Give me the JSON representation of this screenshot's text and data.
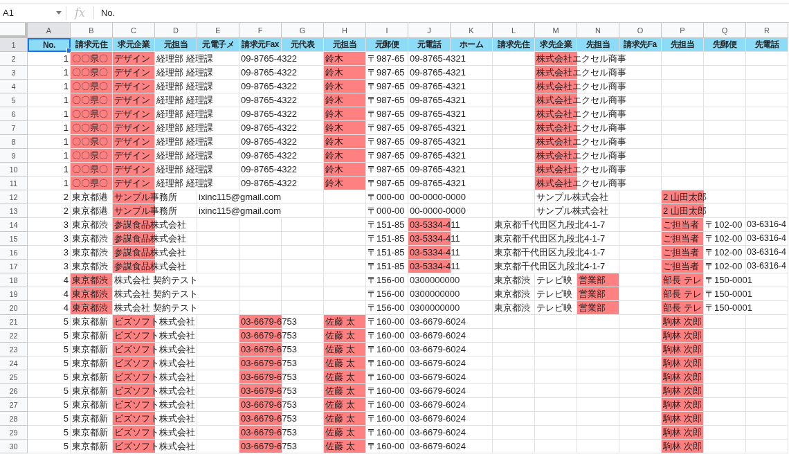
{
  "formula_bar": {
    "cell_ref": "A1",
    "function_label": "fx",
    "formula": "No."
  },
  "columns": [
    {
      "label": "A",
      "selected": true
    },
    {
      "label": "B",
      "selected": false
    },
    {
      "label": "C",
      "selected": false
    },
    {
      "label": "D",
      "selected": false
    },
    {
      "label": "E",
      "selected": false
    },
    {
      "label": "F",
      "selected": false
    },
    {
      "label": "G",
      "selected": false
    },
    {
      "label": "H",
      "selected": false
    },
    {
      "label": "I",
      "selected": false
    },
    {
      "label": "J",
      "selected": false
    },
    {
      "label": "K",
      "selected": false
    },
    {
      "label": "L",
      "selected": false
    },
    {
      "label": "M",
      "selected": false
    },
    {
      "label": "N",
      "selected": false
    },
    {
      "label": "O",
      "selected": false
    },
    {
      "label": "P",
      "selected": false
    },
    {
      "label": "Q",
      "selected": false
    },
    {
      "label": "R",
      "selected": false
    }
  ],
  "rows": [
    {
      "number": "1",
      "selected": true,
      "kind": "header",
      "col_a": "No.",
      "col_a_selected": true,
      "cells": [
        {
          "text": "請求元住",
          "highlight": false
        },
        {
          "text": "求元企業",
          "highlight": false
        },
        {
          "text": "元担当",
          "highlight": false
        },
        {
          "text": "元電子メ",
          "highlight": false
        },
        {
          "text": "請求元Fax",
          "highlight": false
        },
        {
          "text": "元代表",
          "highlight": false
        },
        {
          "text": "元担当",
          "highlight": false
        },
        {
          "text": "元郵便",
          "highlight": false
        },
        {
          "text": "元電話",
          "highlight": false
        },
        {
          "text": "ホーム",
          "highlight": false
        },
        {
          "text": "請求先住",
          "highlight": false
        },
        {
          "text": "求先企業",
          "highlight": false
        },
        {
          "text": "先担当",
          "highlight": false
        },
        {
          "text": "請求先Fa",
          "highlight": false
        },
        {
          "text": "先担当",
          "highlight": false
        },
        {
          "text": "先郵便",
          "highlight": false
        },
        {
          "text": "先電話",
          "highlight": false
        }
      ]
    },
    {
      "number": "2",
      "selected": false,
      "kind": "data",
      "col_a": "1",
      "col_a_selected": false,
      "cells": [
        {
          "text": "〇〇県〇",
          "highlight": true
        },
        {
          "text": "デザイン",
          "highlight": true
        },
        {
          "text": "経理部 経理課",
          "highlight": false
        },
        {
          "highlight": false
        },
        {
          "text": "09-8765-4322",
          "highlight": false
        },
        {
          "highlight": false
        },
        {
          "text": "鈴木",
          "highlight": true
        },
        {
          "text": "〒987-65",
          "highlight": false
        },
        {
          "text": "09-8765-4321",
          "highlight": false
        },
        {
          "highlight": false
        },
        {
          "highlight": false
        },
        {
          "text": "株式会社エクセル商事",
          "highlight": true
        },
        {
          "highlight": false
        },
        {
          "highlight": false
        },
        {
          "highlight": false
        },
        {
          "highlight": false
        },
        {
          "highlight": false
        }
      ]
    },
    {
      "number": "3",
      "selected": false,
      "kind": "data",
      "col_a": "1",
      "col_a_selected": false,
      "cells": [
        {
          "text": "〇〇県〇",
          "highlight": true
        },
        {
          "text": "デザイン",
          "highlight": true
        },
        {
          "text": "経理部 経理課",
          "highlight": false
        },
        {
          "highlight": false
        },
        {
          "text": "09-8765-4322",
          "highlight": false
        },
        {
          "highlight": false
        },
        {
          "text": "鈴木",
          "highlight": true
        },
        {
          "text": "〒987-65",
          "highlight": false
        },
        {
          "text": "09-8765-4321",
          "highlight": false
        },
        {
          "highlight": false
        },
        {
          "highlight": false
        },
        {
          "text": "株式会社エクセル商事",
          "highlight": true
        },
        {
          "highlight": false
        },
        {
          "highlight": false
        },
        {
          "highlight": false
        },
        {
          "highlight": false
        },
        {
          "highlight": false
        }
      ]
    },
    {
      "number": "4",
      "selected": false,
      "kind": "data",
      "col_a": "1",
      "col_a_selected": false,
      "cells": [
        {
          "text": "〇〇県〇",
          "highlight": true
        },
        {
          "text": "デザイン",
          "highlight": true
        },
        {
          "text": "経理部 経理課",
          "highlight": false
        },
        {
          "highlight": false
        },
        {
          "text": "09-8765-4322",
          "highlight": false
        },
        {
          "highlight": false
        },
        {
          "text": "鈴木",
          "highlight": true
        },
        {
          "text": "〒987-65",
          "highlight": false
        },
        {
          "text": "09-8765-4321",
          "highlight": false
        },
        {
          "highlight": false
        },
        {
          "highlight": false
        },
        {
          "text": "株式会社エクセル商事",
          "highlight": true
        },
        {
          "highlight": false
        },
        {
          "highlight": false
        },
        {
          "highlight": false
        },
        {
          "highlight": false
        },
        {
          "highlight": false
        }
      ]
    },
    {
      "number": "5",
      "selected": false,
      "kind": "data",
      "col_a": "1",
      "col_a_selected": false,
      "cells": [
        {
          "text": "〇〇県〇",
          "highlight": true
        },
        {
          "text": "デザイン",
          "highlight": true
        },
        {
          "text": "経理部 経理課",
          "highlight": false
        },
        {
          "highlight": false
        },
        {
          "text": "09-8765-4322",
          "highlight": false
        },
        {
          "highlight": false
        },
        {
          "text": "鈴木",
          "highlight": true
        },
        {
          "text": "〒987-65",
          "highlight": false
        },
        {
          "text": "09-8765-4321",
          "highlight": false
        },
        {
          "highlight": false
        },
        {
          "highlight": false
        },
        {
          "text": "株式会社エクセル商事",
          "highlight": true
        },
        {
          "highlight": false
        },
        {
          "highlight": false
        },
        {
          "highlight": false
        },
        {
          "highlight": false
        },
        {
          "highlight": false
        }
      ]
    },
    {
      "number": "6",
      "selected": false,
      "kind": "data",
      "col_a": "1",
      "col_a_selected": false,
      "cells": [
        {
          "text": "〇〇県〇",
          "highlight": true
        },
        {
          "text": "デザイン",
          "highlight": true
        },
        {
          "text": "経理部 経理課",
          "highlight": false
        },
        {
          "highlight": false
        },
        {
          "text": "09-8765-4322",
          "highlight": false
        },
        {
          "highlight": false
        },
        {
          "text": "鈴木",
          "highlight": true
        },
        {
          "text": "〒987-65",
          "highlight": false
        },
        {
          "text": "09-8765-4321",
          "highlight": false
        },
        {
          "highlight": false
        },
        {
          "highlight": false
        },
        {
          "text": "株式会社エクセル商事",
          "highlight": true
        },
        {
          "highlight": false
        },
        {
          "highlight": false
        },
        {
          "highlight": false
        },
        {
          "highlight": false
        },
        {
          "highlight": false
        }
      ]
    },
    {
      "number": "7",
      "selected": false,
      "kind": "data",
      "col_a": "1",
      "col_a_selected": false,
      "cells": [
        {
          "text": "〇〇県〇",
          "highlight": true
        },
        {
          "text": "デザイン",
          "highlight": true
        },
        {
          "text": "経理部 経理課",
          "highlight": false
        },
        {
          "highlight": false
        },
        {
          "text": "09-8765-4322",
          "highlight": false
        },
        {
          "highlight": false
        },
        {
          "text": "鈴木",
          "highlight": true
        },
        {
          "text": "〒987-65",
          "highlight": false
        },
        {
          "text": "09-8765-4321",
          "highlight": false
        },
        {
          "highlight": false
        },
        {
          "highlight": false
        },
        {
          "text": "株式会社エクセル商事",
          "highlight": true
        },
        {
          "highlight": false
        },
        {
          "highlight": false
        },
        {
          "highlight": false
        },
        {
          "highlight": false
        },
        {
          "highlight": false
        }
      ]
    },
    {
      "number": "8",
      "selected": false,
      "kind": "data",
      "col_a": "1",
      "col_a_selected": false,
      "cells": [
        {
          "text": "〇〇県〇",
          "highlight": true
        },
        {
          "text": "デザイン",
          "highlight": true
        },
        {
          "text": "経理部 経理課",
          "highlight": false
        },
        {
          "highlight": false
        },
        {
          "text": "09-8765-4322",
          "highlight": false
        },
        {
          "highlight": false
        },
        {
          "text": "鈴木",
          "highlight": true
        },
        {
          "text": "〒987-65",
          "highlight": false
        },
        {
          "text": "09-8765-4321",
          "highlight": false
        },
        {
          "highlight": false
        },
        {
          "highlight": false
        },
        {
          "text": "株式会社エクセル商事",
          "highlight": true
        },
        {
          "highlight": false
        },
        {
          "highlight": false
        },
        {
          "highlight": false
        },
        {
          "highlight": false
        },
        {
          "highlight": false
        }
      ]
    },
    {
      "number": "9",
      "selected": false,
      "kind": "data",
      "col_a": "1",
      "col_a_selected": false,
      "cells": [
        {
          "text": "〇〇県〇",
          "highlight": true
        },
        {
          "text": "デザイン",
          "highlight": true
        },
        {
          "text": "経理部 経理課",
          "highlight": false
        },
        {
          "highlight": false
        },
        {
          "text": "09-8765-4322",
          "highlight": false
        },
        {
          "highlight": false
        },
        {
          "text": "鈴木",
          "highlight": true
        },
        {
          "text": "〒987-65",
          "highlight": false
        },
        {
          "text": "09-8765-4321",
          "highlight": false
        },
        {
          "highlight": false
        },
        {
          "highlight": false
        },
        {
          "text": "株式会社エクセル商事",
          "highlight": true
        },
        {
          "highlight": false
        },
        {
          "highlight": false
        },
        {
          "highlight": false
        },
        {
          "highlight": false
        },
        {
          "highlight": false
        }
      ]
    },
    {
      "number": "10",
      "selected": false,
      "kind": "data",
      "col_a": "1",
      "col_a_selected": false,
      "cells": [
        {
          "text": "〇〇県〇",
          "highlight": true
        },
        {
          "text": "デザイン",
          "highlight": true
        },
        {
          "text": "経理部 経理課",
          "highlight": false
        },
        {
          "highlight": false
        },
        {
          "text": "09-8765-4322",
          "highlight": false
        },
        {
          "highlight": false
        },
        {
          "text": "鈴木",
          "highlight": true
        },
        {
          "text": "〒987-65",
          "highlight": false
        },
        {
          "text": "09-8765-4321",
          "highlight": false
        },
        {
          "highlight": false
        },
        {
          "highlight": false
        },
        {
          "text": "株式会社エクセル商事",
          "highlight": true
        },
        {
          "highlight": false
        },
        {
          "highlight": false
        },
        {
          "highlight": false
        },
        {
          "highlight": false
        },
        {
          "highlight": false
        }
      ]
    },
    {
      "number": "11",
      "selected": false,
      "kind": "data",
      "col_a": "1",
      "col_a_selected": false,
      "cells": [
        {
          "text": "〇〇県〇",
          "highlight": true
        },
        {
          "text": "デザイン",
          "highlight": true
        },
        {
          "text": "経理部 経理課",
          "highlight": false
        },
        {
          "highlight": false
        },
        {
          "text": "09-8765-4322",
          "highlight": false
        },
        {
          "highlight": false
        },
        {
          "text": "鈴木",
          "highlight": true
        },
        {
          "text": "〒987-65",
          "highlight": false
        },
        {
          "text": "09-8765-4321",
          "highlight": false
        },
        {
          "highlight": false
        },
        {
          "highlight": false
        },
        {
          "text": "株式会社エクセル商事",
          "highlight": true
        },
        {
          "highlight": false
        },
        {
          "highlight": false
        },
        {
          "highlight": false
        },
        {
          "highlight": false
        },
        {
          "highlight": false
        }
      ]
    },
    {
      "number": "12",
      "selected": false,
      "kind": "data",
      "col_a": "2",
      "col_a_selected": false,
      "cells": [
        {
          "text": "東京都港",
          "highlight": false
        },
        {
          "text": "サンプル事務所",
          "highlight": true
        },
        {
          "highlight": false
        },
        {
          "text": "ixinc115@gmail.com",
          "highlight": false
        },
        {
          "highlight": false
        },
        {
          "highlight": false
        },
        {
          "highlight": false
        },
        {
          "text": "〒000-00",
          "highlight": false
        },
        {
          "text": "00-0000-0000",
          "highlight": false
        },
        {
          "highlight": false
        },
        {
          "highlight": false
        },
        {
          "text": "サンプル株式会社",
          "highlight": false
        },
        {
          "highlight": false
        },
        {
          "highlight": false
        },
        {
          "text": "2 山田太郎",
          "highlight": true
        },
        {
          "highlight": false
        },
        {
          "highlight": false
        }
      ]
    },
    {
      "number": "13",
      "selected": false,
      "kind": "data",
      "col_a": "2",
      "col_a_selected": false,
      "cells": [
        {
          "text": "東京都港",
          "highlight": false
        },
        {
          "text": "サンプル事務所",
          "highlight": true
        },
        {
          "highlight": false
        },
        {
          "text": "ixinc115@gmail.com",
          "highlight": false
        },
        {
          "highlight": false
        },
        {
          "highlight": false
        },
        {
          "highlight": false
        },
        {
          "text": "〒000-00",
          "highlight": false
        },
        {
          "text": "00-0000-0000",
          "highlight": false
        },
        {
          "highlight": false
        },
        {
          "highlight": false
        },
        {
          "text": "サンプル株式会社",
          "highlight": false
        },
        {
          "highlight": false
        },
        {
          "highlight": false
        },
        {
          "text": "2 山田太郎",
          "highlight": true
        },
        {
          "highlight": false
        },
        {
          "highlight": false
        }
      ]
    },
    {
      "number": "14",
      "selected": false,
      "kind": "data",
      "col_a": "3",
      "col_a_selected": false,
      "cells": [
        {
          "text": "東京都渋",
          "highlight": false
        },
        {
          "text": "参謀食品株式会社",
          "highlight": true
        },
        {
          "highlight": false
        },
        {
          "highlight": false
        },
        {
          "highlight": false
        },
        {
          "highlight": false
        },
        {
          "highlight": false
        },
        {
          "text": "〒151-85",
          "highlight": false
        },
        {
          "text": "03-5334-411",
          "highlight": true
        },
        {
          "highlight": false
        },
        {
          "text": "東京都千代田区九段北4-1-7",
          "highlight": false
        },
        {
          "highlight": false
        },
        {
          "highlight": false
        },
        {
          "highlight": false
        },
        {
          "text": "ご担当者",
          "highlight": true
        },
        {
          "text": "〒102-00",
          "highlight": false
        },
        {
          "text": "03-6316-4",
          "highlight": false
        }
      ]
    },
    {
      "number": "15",
      "selected": false,
      "kind": "data",
      "col_a": "3",
      "col_a_selected": false,
      "cells": [
        {
          "text": "東京都渋",
          "highlight": false
        },
        {
          "text": "参謀食品株式会社",
          "highlight": true
        },
        {
          "highlight": false
        },
        {
          "highlight": false
        },
        {
          "highlight": false
        },
        {
          "highlight": false
        },
        {
          "highlight": false
        },
        {
          "text": "〒151-85",
          "highlight": false
        },
        {
          "text": "03-5334-411",
          "highlight": true
        },
        {
          "highlight": false
        },
        {
          "text": "東京都千代田区九段北4-1-7",
          "highlight": false
        },
        {
          "highlight": false
        },
        {
          "highlight": false
        },
        {
          "highlight": false
        },
        {
          "text": "ご担当者",
          "highlight": true
        },
        {
          "text": "〒102-00",
          "highlight": false
        },
        {
          "text": "03-6316-4",
          "highlight": false
        }
      ]
    },
    {
      "number": "16",
      "selected": false,
      "kind": "data",
      "col_a": "3",
      "col_a_selected": false,
      "cells": [
        {
          "text": "東京都渋",
          "highlight": false
        },
        {
          "text": "参謀食品株式会社",
          "highlight": true
        },
        {
          "highlight": false
        },
        {
          "highlight": false
        },
        {
          "highlight": false
        },
        {
          "highlight": false
        },
        {
          "highlight": false
        },
        {
          "text": "〒151-85",
          "highlight": false
        },
        {
          "text": "03-5334-411",
          "highlight": true
        },
        {
          "highlight": false
        },
        {
          "text": "東京都千代田区九段北4-1-7",
          "highlight": false
        },
        {
          "highlight": false
        },
        {
          "highlight": false
        },
        {
          "highlight": false
        },
        {
          "text": "ご担当者",
          "highlight": true
        },
        {
          "text": "〒102-00",
          "highlight": false
        },
        {
          "text": "03-6316-4",
          "highlight": false
        }
      ]
    },
    {
      "number": "17",
      "selected": false,
      "kind": "data",
      "col_a": "3",
      "col_a_selected": false,
      "cells": [
        {
          "text": "東京都渋",
          "highlight": false
        },
        {
          "text": "参謀食品株式会社",
          "highlight": true
        },
        {
          "highlight": false
        },
        {
          "highlight": false
        },
        {
          "highlight": false
        },
        {
          "highlight": false
        },
        {
          "highlight": false
        },
        {
          "text": "〒151-85",
          "highlight": false
        },
        {
          "text": "03-5334-411",
          "highlight": true
        },
        {
          "highlight": false
        },
        {
          "text": "東京都千代田区九段北4-1-7",
          "highlight": false
        },
        {
          "highlight": false
        },
        {
          "highlight": false
        },
        {
          "highlight": false
        },
        {
          "text": "ご担当者",
          "highlight": true
        },
        {
          "text": "〒102-00",
          "highlight": false
        },
        {
          "text": "03-6316-4",
          "highlight": false
        }
      ]
    },
    {
      "number": "18",
      "selected": false,
      "kind": "data",
      "col_a": "4",
      "col_a_selected": false,
      "cells": [
        {
          "text": "東京都渋",
          "highlight": true
        },
        {
          "text": "株式会社 契約テスト",
          "highlight": false
        },
        {
          "highlight": false
        },
        {
          "highlight": false
        },
        {
          "highlight": false
        },
        {
          "highlight": false
        },
        {
          "highlight": false
        },
        {
          "text": "〒156-00",
          "highlight": false
        },
        {
          "text": "0300000000",
          "highlight": false
        },
        {
          "highlight": false
        },
        {
          "text": "東京都渋",
          "highlight": false
        },
        {
          "text": "テレビ映",
          "highlight": false
        },
        {
          "text": "営業部",
          "highlight": true
        },
        {
          "highlight": false
        },
        {
          "text": "部長 テレ",
          "highlight": true
        },
        {
          "text": "〒150-0001",
          "highlight": false
        },
        {
          "highlight": false
        }
      ]
    },
    {
      "number": "19",
      "selected": false,
      "kind": "data",
      "col_a": "4",
      "col_a_selected": false,
      "cells": [
        {
          "text": "東京都渋",
          "highlight": true
        },
        {
          "text": "株式会社 契約テスト",
          "highlight": false
        },
        {
          "highlight": false
        },
        {
          "highlight": false
        },
        {
          "highlight": false
        },
        {
          "highlight": false
        },
        {
          "highlight": false
        },
        {
          "text": "〒156-00",
          "highlight": false
        },
        {
          "text": "0300000000",
          "highlight": false
        },
        {
          "highlight": false
        },
        {
          "text": "東京都渋",
          "highlight": false
        },
        {
          "text": "テレビ映",
          "highlight": false
        },
        {
          "text": "営業部",
          "highlight": true
        },
        {
          "highlight": false
        },
        {
          "text": "部長 テレ",
          "highlight": true
        },
        {
          "text": "〒150-0001",
          "highlight": false
        },
        {
          "highlight": false
        }
      ]
    },
    {
      "number": "20",
      "selected": false,
      "kind": "data",
      "col_a": "4",
      "col_a_selected": false,
      "cells": [
        {
          "text": "東京都渋",
          "highlight": true
        },
        {
          "text": "株式会社 契約テスト",
          "highlight": false
        },
        {
          "highlight": false
        },
        {
          "highlight": false
        },
        {
          "highlight": false
        },
        {
          "highlight": false
        },
        {
          "highlight": false
        },
        {
          "text": "〒156-00",
          "highlight": false
        },
        {
          "text": "0300000000",
          "highlight": false
        },
        {
          "highlight": false
        },
        {
          "text": "東京都渋",
          "highlight": false
        },
        {
          "text": "テレビ映",
          "highlight": false
        },
        {
          "text": "営業部",
          "highlight": true
        },
        {
          "highlight": false
        },
        {
          "text": "部長 テレ",
          "highlight": true
        },
        {
          "text": "〒150-0001",
          "highlight": false
        },
        {
          "highlight": false
        }
      ]
    },
    {
      "number": "21",
      "selected": false,
      "kind": "data",
      "col_a": "5",
      "col_a_selected": false,
      "cells": [
        {
          "text": "東京都新",
          "highlight": false
        },
        {
          "text": "ビズソフト株式会社",
          "highlight": true
        },
        {
          "highlight": false
        },
        {
          "highlight": false
        },
        {
          "text": "03-6679-6753",
          "highlight": true
        },
        {
          "highlight": false
        },
        {
          "text": "佐藤 太",
          "highlight": true
        },
        {
          "text": "〒160-00",
          "highlight": false
        },
        {
          "text": "03-6679-6024",
          "highlight": false
        },
        {
          "highlight": false
        },
        {
          "highlight": false
        },
        {
          "highlight": false
        },
        {
          "highlight": false
        },
        {
          "highlight": false
        },
        {
          "text": "駒林 次郎",
          "highlight": true
        },
        {
          "highlight": false
        },
        {
          "highlight": false
        }
      ]
    },
    {
      "number": "22",
      "selected": false,
      "kind": "data",
      "col_a": "5",
      "col_a_selected": false,
      "cells": [
        {
          "text": "東京都新",
          "highlight": false
        },
        {
          "text": "ビズソフト株式会社",
          "highlight": true
        },
        {
          "highlight": false
        },
        {
          "highlight": false
        },
        {
          "text": "03-6679-6753",
          "highlight": true
        },
        {
          "highlight": false
        },
        {
          "text": "佐藤 太",
          "highlight": true
        },
        {
          "text": "〒160-00",
          "highlight": false
        },
        {
          "text": "03-6679-6024",
          "highlight": false
        },
        {
          "highlight": false
        },
        {
          "highlight": false
        },
        {
          "highlight": false
        },
        {
          "highlight": false
        },
        {
          "highlight": false
        },
        {
          "text": "駒林 次郎",
          "highlight": true
        },
        {
          "highlight": false
        },
        {
          "highlight": false
        }
      ]
    },
    {
      "number": "23",
      "selected": false,
      "kind": "data",
      "col_a": "5",
      "col_a_selected": false,
      "cells": [
        {
          "text": "東京都新",
          "highlight": false
        },
        {
          "text": "ビズソフト株式会社",
          "highlight": true
        },
        {
          "highlight": false
        },
        {
          "highlight": false
        },
        {
          "text": "03-6679-6753",
          "highlight": true
        },
        {
          "highlight": false
        },
        {
          "text": "佐藤 太",
          "highlight": true
        },
        {
          "text": "〒160-00",
          "highlight": false
        },
        {
          "text": "03-6679-6024",
          "highlight": false
        },
        {
          "highlight": false
        },
        {
          "highlight": false
        },
        {
          "highlight": false
        },
        {
          "highlight": false
        },
        {
          "highlight": false
        },
        {
          "text": "駒林 次郎",
          "highlight": true
        },
        {
          "highlight": false
        },
        {
          "highlight": false
        }
      ]
    },
    {
      "number": "24",
      "selected": false,
      "kind": "data",
      "col_a": "5",
      "col_a_selected": false,
      "cells": [
        {
          "text": "東京都新",
          "highlight": false
        },
        {
          "text": "ビズソフト株式会社",
          "highlight": true
        },
        {
          "highlight": false
        },
        {
          "highlight": false
        },
        {
          "text": "03-6679-6753",
          "highlight": true
        },
        {
          "highlight": false
        },
        {
          "text": "佐藤 太",
          "highlight": true
        },
        {
          "text": "〒160-00",
          "highlight": false
        },
        {
          "text": "03-6679-6024",
          "highlight": false
        },
        {
          "highlight": false
        },
        {
          "highlight": false
        },
        {
          "highlight": false
        },
        {
          "highlight": false
        },
        {
          "highlight": false
        },
        {
          "text": "駒林 次郎",
          "highlight": true
        },
        {
          "highlight": false
        },
        {
          "highlight": false
        }
      ]
    },
    {
      "number": "25",
      "selected": false,
      "kind": "data",
      "col_a": "5",
      "col_a_selected": false,
      "cells": [
        {
          "text": "東京都新",
          "highlight": false
        },
        {
          "text": "ビズソフト株式会社",
          "highlight": true
        },
        {
          "highlight": false
        },
        {
          "highlight": false
        },
        {
          "text": "03-6679-6753",
          "highlight": true
        },
        {
          "highlight": false
        },
        {
          "text": "佐藤 太",
          "highlight": true
        },
        {
          "text": "〒160-00",
          "highlight": false
        },
        {
          "text": "03-6679-6024",
          "highlight": false
        },
        {
          "highlight": false
        },
        {
          "highlight": false
        },
        {
          "highlight": false
        },
        {
          "highlight": false
        },
        {
          "highlight": false
        },
        {
          "text": "駒林 次郎",
          "highlight": true
        },
        {
          "highlight": false
        },
        {
          "highlight": false
        }
      ]
    },
    {
      "number": "26",
      "selected": false,
      "kind": "data",
      "col_a": "5",
      "col_a_selected": false,
      "cells": [
        {
          "text": "東京都新",
          "highlight": false
        },
        {
          "text": "ビズソフト株式会社",
          "highlight": true
        },
        {
          "highlight": false
        },
        {
          "highlight": false
        },
        {
          "text": "03-6679-6753",
          "highlight": true
        },
        {
          "highlight": false
        },
        {
          "text": "佐藤 太",
          "highlight": true
        },
        {
          "text": "〒160-00",
          "highlight": false
        },
        {
          "text": "03-6679-6024",
          "highlight": false
        },
        {
          "highlight": false
        },
        {
          "highlight": false
        },
        {
          "highlight": false
        },
        {
          "highlight": false
        },
        {
          "highlight": false
        },
        {
          "text": "駒林 次郎",
          "highlight": true
        },
        {
          "highlight": false
        },
        {
          "highlight": false
        }
      ]
    },
    {
      "number": "27",
      "selected": false,
      "kind": "data",
      "col_a": "5",
      "col_a_selected": false,
      "cells": [
        {
          "text": "東京都新",
          "highlight": false
        },
        {
          "text": "ビズソフト株式会社",
          "highlight": true
        },
        {
          "highlight": false
        },
        {
          "highlight": false
        },
        {
          "text": "03-6679-6753",
          "highlight": true
        },
        {
          "highlight": false
        },
        {
          "text": "佐藤 太",
          "highlight": true
        },
        {
          "text": "〒160-00",
          "highlight": false
        },
        {
          "text": "03-6679-6024",
          "highlight": false
        },
        {
          "highlight": false
        },
        {
          "highlight": false
        },
        {
          "highlight": false
        },
        {
          "highlight": false
        },
        {
          "highlight": false
        },
        {
          "text": "駒林 次郎",
          "highlight": true
        },
        {
          "highlight": false
        },
        {
          "highlight": false
        }
      ]
    },
    {
      "number": "28",
      "selected": false,
      "kind": "data",
      "col_a": "5",
      "col_a_selected": false,
      "cells": [
        {
          "text": "東京都新",
          "highlight": false
        },
        {
          "text": "ビズソフト株式会社",
          "highlight": true
        },
        {
          "highlight": false
        },
        {
          "highlight": false
        },
        {
          "text": "03-6679-6753",
          "highlight": true
        },
        {
          "highlight": false
        },
        {
          "text": "佐藤 太",
          "highlight": true
        },
        {
          "text": "〒160-00",
          "highlight": false
        },
        {
          "text": "03-6679-6024",
          "highlight": false
        },
        {
          "highlight": false
        },
        {
          "highlight": false
        },
        {
          "highlight": false
        },
        {
          "highlight": false
        },
        {
          "highlight": false
        },
        {
          "text": "駒林 次郎",
          "highlight": true
        },
        {
          "highlight": false
        },
        {
          "highlight": false
        }
      ]
    },
    {
      "number": "29",
      "selected": false,
      "kind": "data",
      "col_a": "5",
      "col_a_selected": false,
      "cells": [
        {
          "text": "東京都新",
          "highlight": false
        },
        {
          "text": "ビズソフト株式会社",
          "highlight": true
        },
        {
          "highlight": false
        },
        {
          "highlight": false
        },
        {
          "text": "03-6679-6753",
          "highlight": true
        },
        {
          "highlight": false
        },
        {
          "text": "佐藤 太",
          "highlight": true
        },
        {
          "text": "〒160-00",
          "highlight": false
        },
        {
          "text": "03-6679-6024",
          "highlight": false
        },
        {
          "highlight": false
        },
        {
          "highlight": false
        },
        {
          "highlight": false
        },
        {
          "highlight": false
        },
        {
          "highlight": false
        },
        {
          "text": "駒林 次郎",
          "highlight": true
        },
        {
          "highlight": false
        },
        {
          "highlight": false
        }
      ]
    },
    {
      "number": "30",
      "selected": false,
      "kind": "data",
      "col_a": "5",
      "col_a_selected": false,
      "cells": [
        {
          "text": "東京都新",
          "highlight": false
        },
        {
          "text": "ビズソフト株式会社",
          "highlight": true
        },
        {
          "highlight": false
        },
        {
          "highlight": false
        },
        {
          "text": "03-6679-6753",
          "highlight": true
        },
        {
          "highlight": false
        },
        {
          "text": "佐藤 太",
          "highlight": true
        },
        {
          "text": "〒160-00",
          "highlight": false
        },
        {
          "text": "03-6679-6024",
          "highlight": false
        },
        {
          "highlight": false
        },
        {
          "highlight": false
        },
        {
          "highlight": false
        },
        {
          "highlight": false
        },
        {
          "highlight": false
        },
        {
          "text": "駒林 次郎",
          "highlight": true
        },
        {
          "highlight": false
        },
        {
          "highlight": false
        }
      ]
    }
  ]
}
